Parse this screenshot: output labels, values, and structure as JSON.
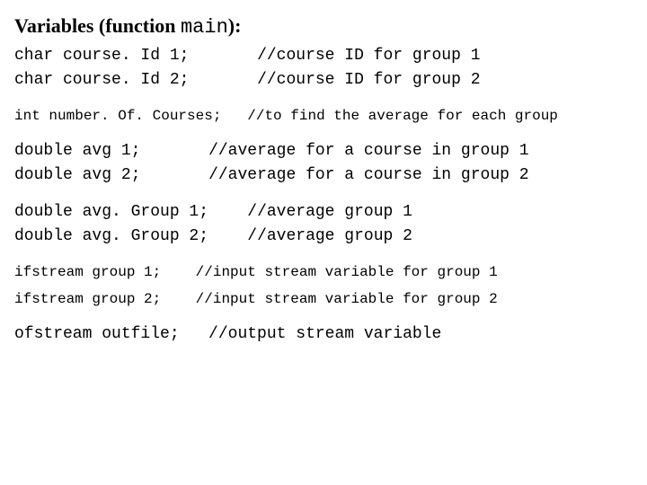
{
  "heading": {
    "prefix": "Variables (function ",
    "func": "main",
    "suffix": "):"
  },
  "lines": {
    "l1": {
      "decl": "char course. Id 1;",
      "comment": "//course ID for group 1"
    },
    "l2": {
      "decl": "char course. Id 2;",
      "comment": "//course ID for group 2"
    },
    "l3": {
      "decl": "int number. Of. Courses;",
      "comment": "//to find the average for each group"
    },
    "l4": {
      "decl": "double avg 1;",
      "comment": "//average for a course in group 1"
    },
    "l5": {
      "decl": "double avg 2;",
      "comment": "//average for a course in group 2"
    },
    "l6": {
      "decl": "double avg. Group 1;",
      "comment": "//average group 1"
    },
    "l7": {
      "decl": "double avg. Group 2;",
      "comment": "//average group 2"
    },
    "l8": {
      "decl": "ifstream group 1;",
      "comment": "//input stream variable for group 1"
    },
    "l9": {
      "decl": "ifstream group 2;",
      "comment": "//input stream variable for group 2"
    },
    "l10": {
      "decl": "ofstream outfile;",
      "comment": "//output stream variable"
    }
  },
  "pads": {
    "p1": "       ",
    "p2": "       ",
    "p3": "   ",
    "p4": "       ",
    "p5": "       ",
    "p6": "    ",
    "p7": "    ",
    "p8": "    ",
    "p9": "    ",
    "p10": "   "
  }
}
